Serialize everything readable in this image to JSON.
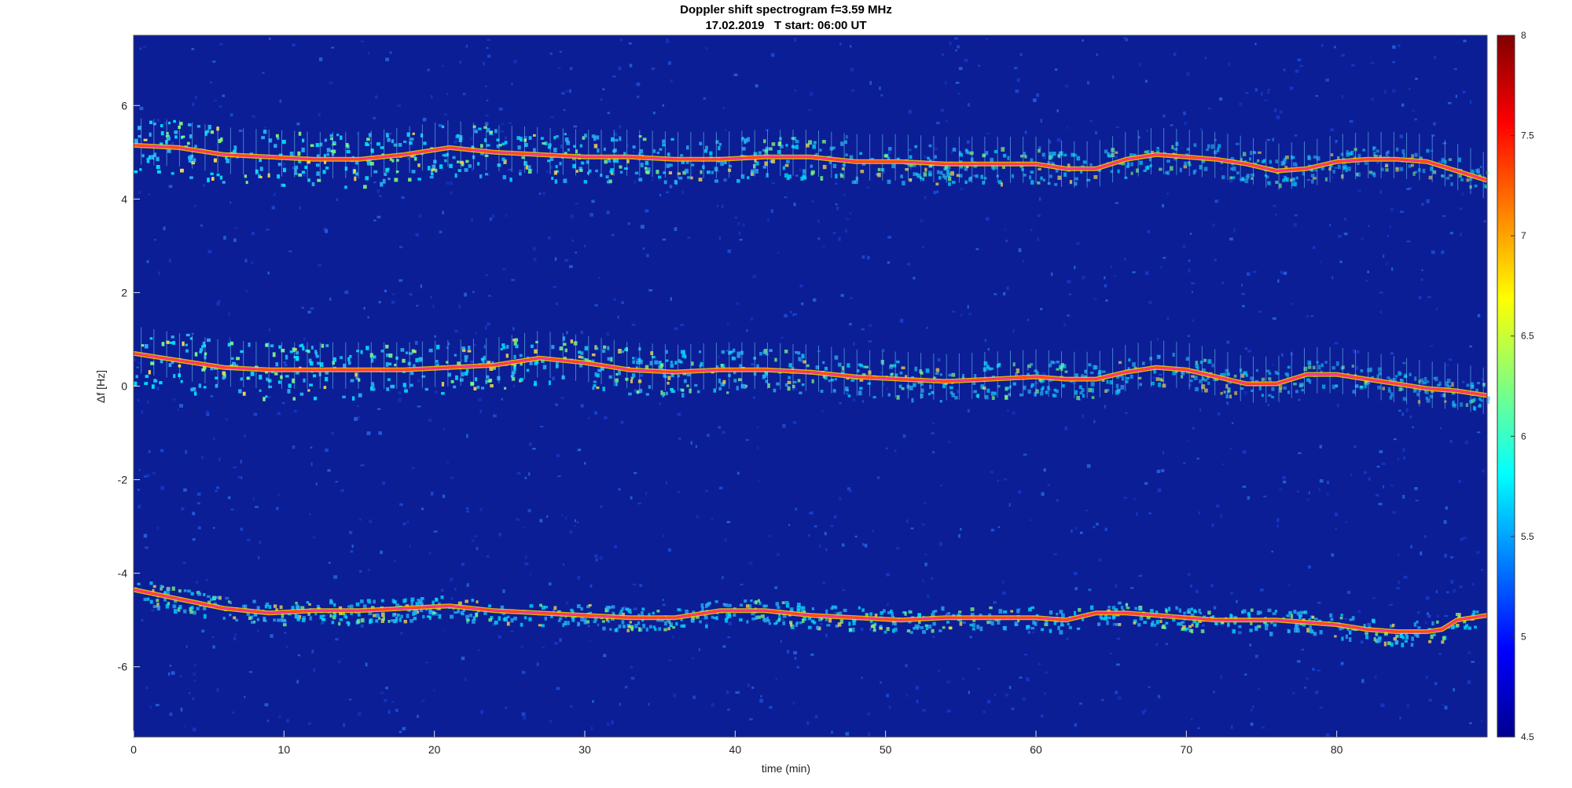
{
  "chart_data": {
    "type": "heatmap",
    "title": "Doppler shift spectrogram f=3.59 MHz",
    "subtitle": "17.02.2019   T start: 06:00 UT",
    "xlabel": "time (min)",
    "ylabel": "Δf [Hz]",
    "xlim": [
      0,
      90
    ],
    "ylim": [
      -7.5,
      7.5
    ],
    "xticks": [
      0,
      10,
      20,
      30,
      40,
      50,
      60,
      70,
      80
    ],
    "yticks": [
      -6,
      -4,
      -2,
      0,
      2,
      4,
      6
    ],
    "colorbar": {
      "colormap": "jet",
      "clim": [
        4.5,
        8
      ],
      "ticks": [
        4.5,
        5,
        5.5,
        6,
        6.5,
        7,
        7.5,
        8
      ]
    },
    "series": [
      {
        "x": [
          0,
          3,
          6,
          9,
          12,
          15,
          18,
          21,
          24,
          27,
          30,
          33,
          36,
          39,
          42,
          45,
          48,
          51,
          54,
          57,
          60,
          62,
          64,
          66,
          68,
          70,
          72,
          74,
          76,
          78,
          80,
          82,
          84,
          86,
          88,
          90
        ],
        "y": [
          5.15,
          5.1,
          4.95,
          4.9,
          4.85,
          4.85,
          4.95,
          5.1,
          5.0,
          4.95,
          4.9,
          4.9,
          4.85,
          4.85,
          4.9,
          4.9,
          4.8,
          4.8,
          4.75,
          4.75,
          4.75,
          4.65,
          4.65,
          4.85,
          4.95,
          4.9,
          4.85,
          4.75,
          4.6,
          4.65,
          4.8,
          4.85,
          4.85,
          4.8,
          4.6,
          4.4
        ]
      },
      {
        "x": [
          0,
          3,
          6,
          9,
          12,
          15,
          18,
          21,
          24,
          27,
          30,
          33,
          36,
          39,
          42,
          45,
          48,
          51,
          54,
          57,
          60,
          62,
          64,
          66,
          68,
          70,
          72,
          74,
          76,
          78,
          80,
          82,
          84,
          86,
          88,
          90
        ],
        "y": [
          0.7,
          0.55,
          0.4,
          0.35,
          0.35,
          0.35,
          0.35,
          0.4,
          0.45,
          0.6,
          0.5,
          0.35,
          0.3,
          0.35,
          0.35,
          0.3,
          0.2,
          0.15,
          0.1,
          0.15,
          0.2,
          0.15,
          0.15,
          0.3,
          0.4,
          0.35,
          0.2,
          0.05,
          0.05,
          0.25,
          0.25,
          0.15,
          0.05,
          -0.05,
          -0.1,
          -0.2
        ]
      },
      {
        "x": [
          0,
          3,
          6,
          9,
          12,
          15,
          18,
          21,
          24,
          27,
          30,
          33,
          36,
          39,
          42,
          45,
          48,
          51,
          54,
          57,
          60,
          62,
          64,
          66,
          68,
          70,
          72,
          74,
          76,
          78,
          80,
          82,
          84,
          86,
          87,
          88,
          90
        ],
        "y": [
          -4.35,
          -4.55,
          -4.75,
          -4.85,
          -4.8,
          -4.8,
          -4.75,
          -4.7,
          -4.8,
          -4.85,
          -4.9,
          -4.95,
          -4.95,
          -4.8,
          -4.8,
          -4.9,
          -4.95,
          -5.0,
          -4.95,
          -4.95,
          -4.95,
          -5.0,
          -4.85,
          -4.85,
          -4.9,
          -4.95,
          -5.0,
          -5.0,
          -5.0,
          -5.05,
          -5.1,
          -5.2,
          -5.25,
          -5.25,
          -5.2,
          -5.0,
          -4.9
        ]
      }
    ]
  }
}
